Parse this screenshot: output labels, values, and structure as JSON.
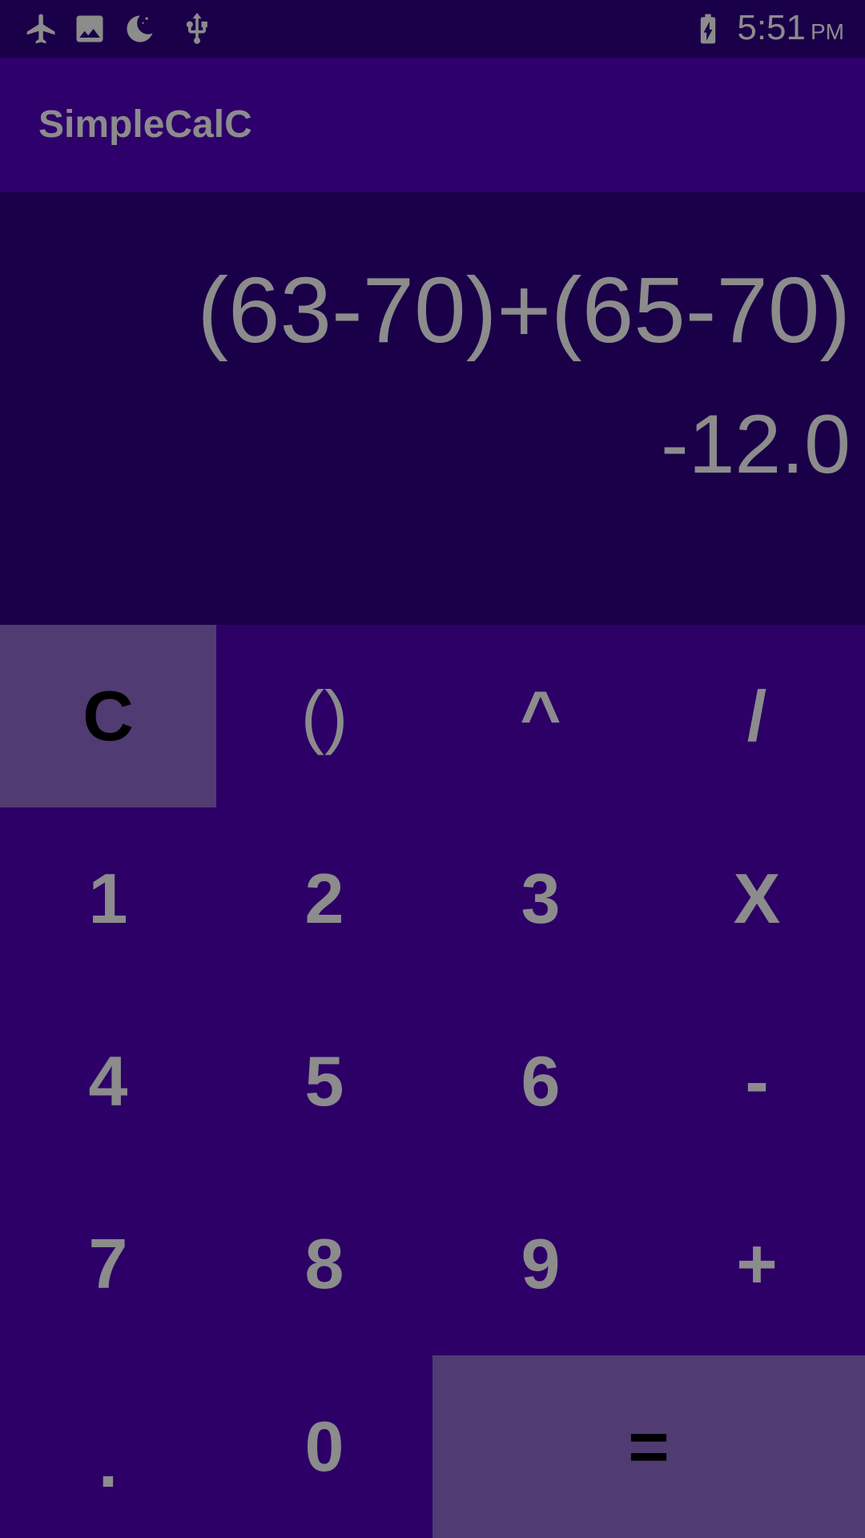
{
  "status_bar": {
    "time": "5:51",
    "ampm": "PM",
    "icons": [
      "airplane-icon",
      "image-icon",
      "moon-icon",
      "usb-icon",
      "battery-charging-icon"
    ]
  },
  "app_bar": {
    "title": "SimpleCalC"
  },
  "display": {
    "expression": "(63-70)+(65-70)",
    "result": "-12.0"
  },
  "keypad": {
    "keys": {
      "clear": "C",
      "paren": "()",
      "power": "^",
      "divide": "/",
      "one": "1",
      "two": "2",
      "three": "3",
      "multiply": "X",
      "four": "4",
      "five": "5",
      "six": "6",
      "minus": "-",
      "seven": "7",
      "eight": "8",
      "nine": "9",
      "plus": "+",
      "dot": ".",
      "zero": "0",
      "equals": "="
    }
  },
  "colors": {
    "status_bar_bg": "#1a0048",
    "app_bar_bg": "#2e006b",
    "display_bg": "#1a0048",
    "keypad_bg": "#2d0067",
    "highlight_key_bg": "#503b73",
    "text_gray": "#8c8c8c"
  }
}
